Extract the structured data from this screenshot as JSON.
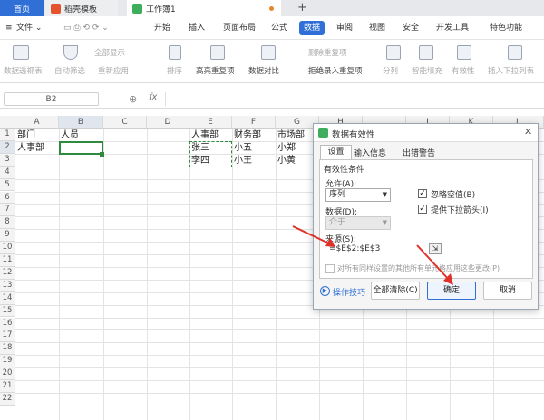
{
  "tabbar": {
    "home": "首页",
    "template": "稻壳模板",
    "workbook": "工作簿1",
    "add": "+"
  },
  "menubar": {
    "file": "文件",
    "items": [
      "开始",
      "插入",
      "页面布局",
      "公式",
      "数据",
      "审阅",
      "视图",
      "安全",
      "开发工具",
      "特色功能"
    ]
  },
  "ribbon": {
    "pivot": "数据透视表",
    "autofilter": "自动筛选",
    "show_all": "全部显示",
    "reapply": "重新应用",
    "sort": "排序",
    "highlight_dup": "高亮重复项",
    "compare": "数据对比",
    "delete_dup": "删除重复项",
    "reject_dup": "拒绝录入重复项",
    "split": "分列",
    "smart_fill": "智能填充",
    "validity": "有效性",
    "insert_dropdown": "插入下拉列表"
  },
  "formulabar": {
    "cell_ref": "B2",
    "fx": "fx"
  },
  "grid": {
    "columns": [
      "A",
      "B",
      "C",
      "D",
      "E",
      "F",
      "G",
      "H",
      "I",
      "J",
      "K",
      "L"
    ],
    "rows": [
      "1",
      "2",
      "3",
      "4",
      "5",
      "6",
      "7",
      "8",
      "9",
      "10",
      "11",
      "12",
      "13",
      "14",
      "15",
      "16",
      "17",
      "18",
      "19",
      "20",
      "21",
      "22"
    ],
    "a1": "部门",
    "b1": "人员",
    "a2": "人事部",
    "e1": "人事部",
    "f1": "财务部",
    "g1": "市场部",
    "e2": "张三",
    "f2": "小五",
    "g2": "小郑",
    "e3": "李四",
    "f3": "小王",
    "g3": "小黄"
  },
  "dialog": {
    "title": "数据有效性",
    "tabs": [
      "设置",
      "输入信息",
      "出错警告"
    ],
    "section": "有效性条件",
    "allow_label": "允许(A):",
    "allow_value": "序列",
    "data_label": "数据(D):",
    "data_value": "介于",
    "ignore_blank": "忽略空值(B)",
    "dropdown": "提供下拉箭头(I)",
    "source_label": "来源(S):",
    "source_value": "=$E$2:$E$3",
    "apply_all": "对所有同样设置的其他所有单元格应用这些更改(P)",
    "tips": "操作技巧",
    "clear_all": "全部清除(C)",
    "ok": "确定",
    "cancel": "取消"
  },
  "colors": {
    "accent": "#2f6fd6",
    "wps_green": "#3fae5c",
    "arrow_red": "#e0302a",
    "selection_green": "#2e8b3e"
  }
}
